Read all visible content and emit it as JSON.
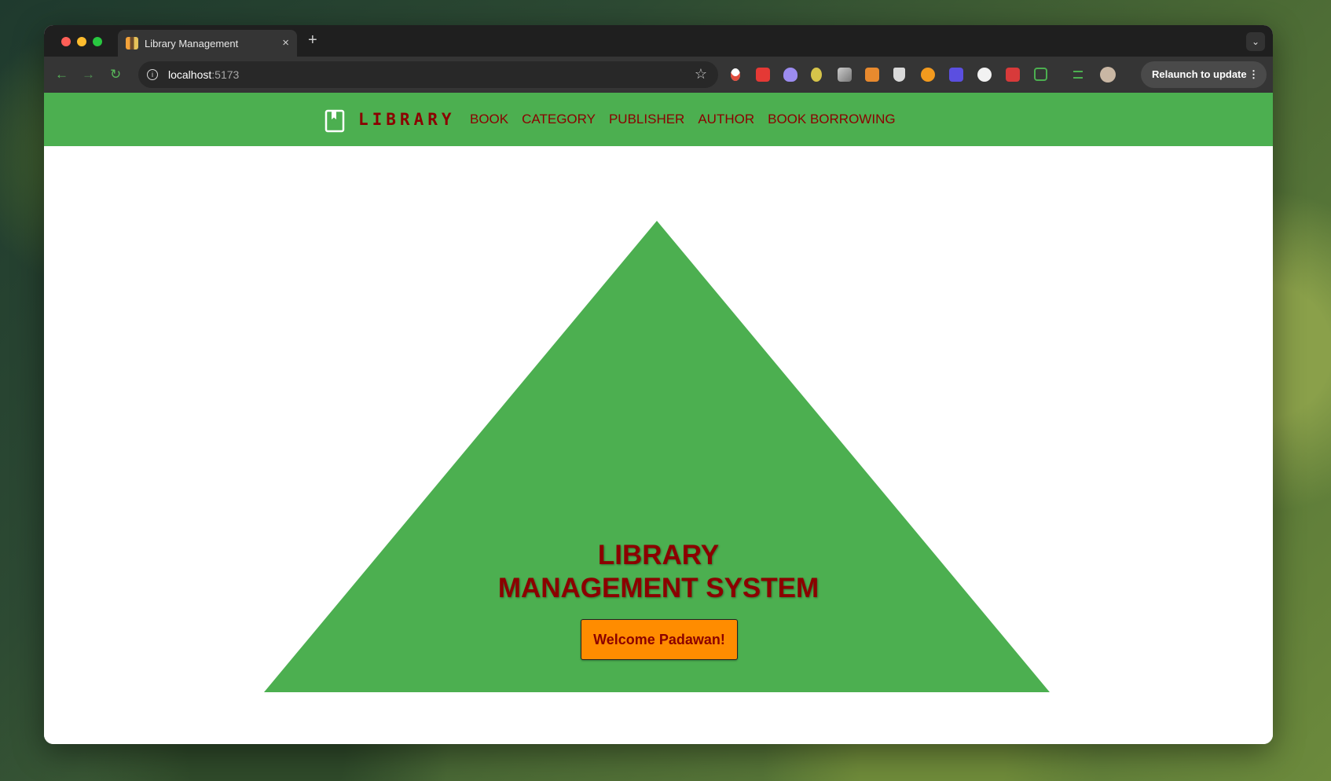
{
  "browser": {
    "tab_title": "Library Management",
    "tab_close": "×",
    "new_tab": "+",
    "tab_menu": "⌄",
    "nav": {
      "back": "←",
      "forward": "→",
      "reload": "↻"
    },
    "address": {
      "host": "localhost",
      "port": ":5173",
      "info": "i",
      "star": "☆"
    },
    "relaunch_label": "Relaunch to update",
    "relaunch_menu": "⋮",
    "extension_icons": [
      "vpn-icon",
      "extension-red-icon",
      "extension-purple-icon",
      "extension-bird-icon",
      "extension-gray-icon",
      "metamask-icon",
      "shield-icon",
      "extension-orange-icon",
      "extension-a-icon",
      "extension-face-icon",
      "extension-red2-icon",
      "puzzle-icon",
      "playlist-icon",
      "profile-avatar"
    ]
  },
  "navbar": {
    "logo_text": "LIBRARY",
    "links": [
      "BOOK",
      "CATEGORY",
      "PUBLISHER",
      "AUTHOR",
      "BOOK BORROWING"
    ]
  },
  "hero": {
    "title_line1": "LIBRARY",
    "title_line2": "MANAGEMENT SYSTEM",
    "button_label": "Welcome Padawan!"
  },
  "colors": {
    "nav_green": "#4caf50",
    "triangle_green": "#4caf50",
    "text_dark_red": "#8b0000",
    "button_orange": "#ff8c00"
  }
}
